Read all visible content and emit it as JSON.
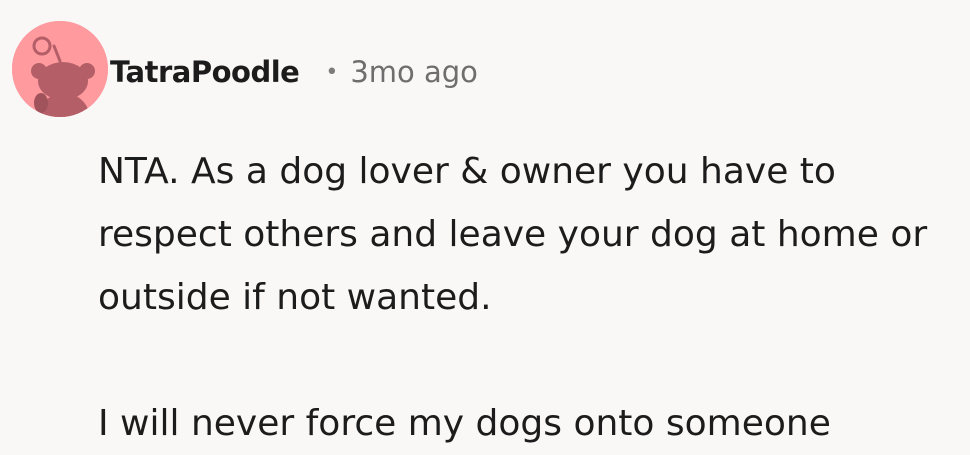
{
  "comment": {
    "author": "TatraPoodle",
    "separator": "•",
    "timestamp": "3mo ago",
    "avatar_icon": "reddit-snoo-avatar-icon",
    "avatar_color": "#ff9a9f",
    "paragraphs": [
      {
        "lines": [
          "NTA. As a dog lover & owner you have to",
          "respect others and leave your dog at home or",
          "outside if not wanted."
        ]
      },
      {
        "lines": [
          "I will never force my dogs onto someone"
        ]
      }
    ]
  }
}
